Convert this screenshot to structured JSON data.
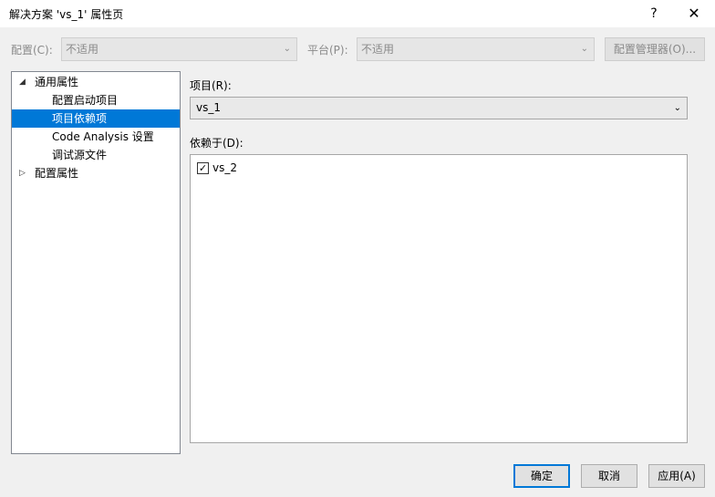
{
  "window": {
    "title": "解决方案 'vs_1' 属性页",
    "help_glyph": "?",
    "close_glyph": "✕"
  },
  "config": {
    "configuration_label": "配置(C):",
    "configuration_value": "不适用",
    "platform_label": "平台(P):",
    "platform_value": "不适用",
    "config_manager_label": "配置管理器(O)..."
  },
  "tree": {
    "items": [
      {
        "label": "通用属性",
        "expanded": true
      },
      {
        "label": "配置启动项目"
      },
      {
        "label": "项目依赖项",
        "selected": true
      },
      {
        "label": "Code Analysis 设置"
      },
      {
        "label": "调试源文件"
      },
      {
        "label": "配置属性",
        "expanded": false
      }
    ]
  },
  "main": {
    "project_label": "项目(R):",
    "project_value": "vs_1",
    "depends_label": "依赖于(D):",
    "dependencies": [
      {
        "label": "vs_2",
        "checked": true
      }
    ]
  },
  "buttons": {
    "ok": "确定",
    "cancel": "取消",
    "apply": "应用(A)"
  },
  "colors": {
    "selection": "#0078d7",
    "dialog_bg": "#f0f0f0"
  }
}
